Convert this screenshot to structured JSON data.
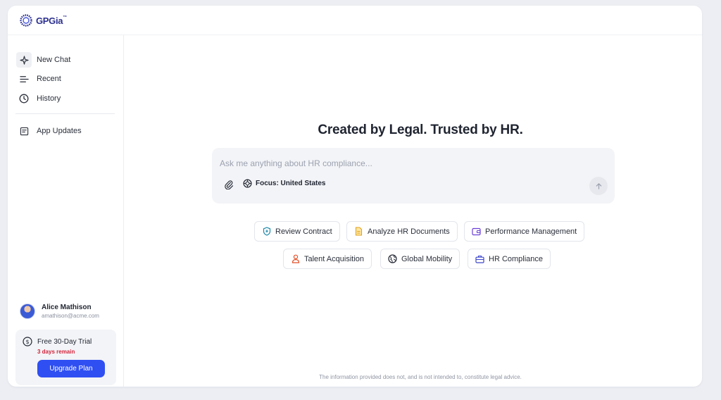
{
  "brand": {
    "name": "GPGia",
    "trademark": "™",
    "color": "#2b2f8f"
  },
  "sidebar": {
    "items": [
      {
        "label": "New Chat",
        "icon": "sparkle-icon"
      },
      {
        "label": "Recent",
        "icon": "lines-icon"
      },
      {
        "label": "History",
        "icon": "clock-icon"
      },
      {
        "label": "App Updates",
        "icon": "document-icon"
      }
    ]
  },
  "user": {
    "name": "Alice Mathison",
    "email": "amathison@acme.com"
  },
  "trial": {
    "title": "Free 30-Day Trial",
    "remaining": "3 days remain",
    "upgrade_label": "Upgrade Plan",
    "accent": "#2f4ff2",
    "alert_color": "#d3243b"
  },
  "main": {
    "headline": "Created by Legal. Trusted by HR.",
    "composer": {
      "placeholder": "Ask me anything about HR compliance...",
      "value": "",
      "focus_label": "Focus: United States"
    },
    "suggestions": [
      {
        "label": "Review Contract",
        "icon": "shield-icon",
        "color": "#1e88a8"
      },
      {
        "label": "Analyze HR Documents",
        "icon": "file-icon",
        "color": "#e0a21a"
      },
      {
        "label": "Performance Management",
        "icon": "wallet-icon",
        "color": "#6a3fd8"
      },
      {
        "label": "Talent Acquisition",
        "icon": "person-icon",
        "color": "#e2522a"
      },
      {
        "label": "Global Mobility",
        "icon": "globe-icon",
        "color": "#1f2430"
      },
      {
        "label": "HR Compliance",
        "icon": "briefcase-icon",
        "color": "#3d46c8"
      }
    ],
    "disclaimer": "The information provided does not, and is not intended to, constitute legal advice."
  }
}
